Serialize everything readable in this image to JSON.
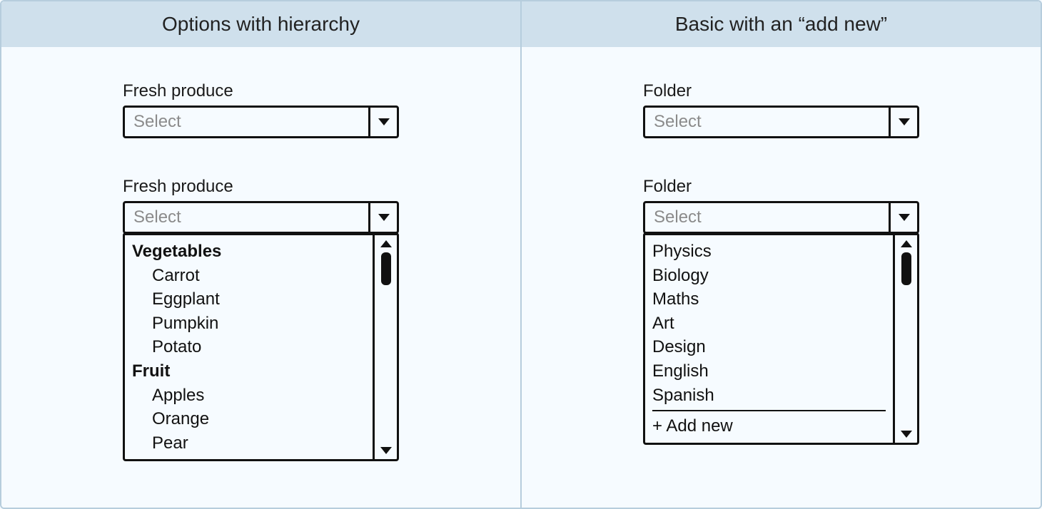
{
  "left": {
    "title": "Options with hierarchy",
    "field1": {
      "label": "Fresh produce",
      "placeholder": "Select"
    },
    "field2": {
      "label": "Fresh produce",
      "placeholder": "Select",
      "groups": [
        {
          "label": "Vegetables",
          "options": [
            "Carrot",
            "Eggplant",
            "Pumpkin",
            "Potato"
          ]
        },
        {
          "label": "Fruit",
          "options": [
            "Apples",
            "Orange",
            "Pear"
          ]
        }
      ]
    }
  },
  "right": {
    "title": "Basic with an “add new”",
    "field1": {
      "label": "Folder",
      "placeholder": "Select"
    },
    "field2": {
      "label": "Folder",
      "placeholder": "Select",
      "options": [
        "Physics",
        "Biology",
        "Maths",
        "Art",
        "Design",
        "English",
        "Spanish"
      ],
      "add_new": "+ Add new"
    }
  }
}
